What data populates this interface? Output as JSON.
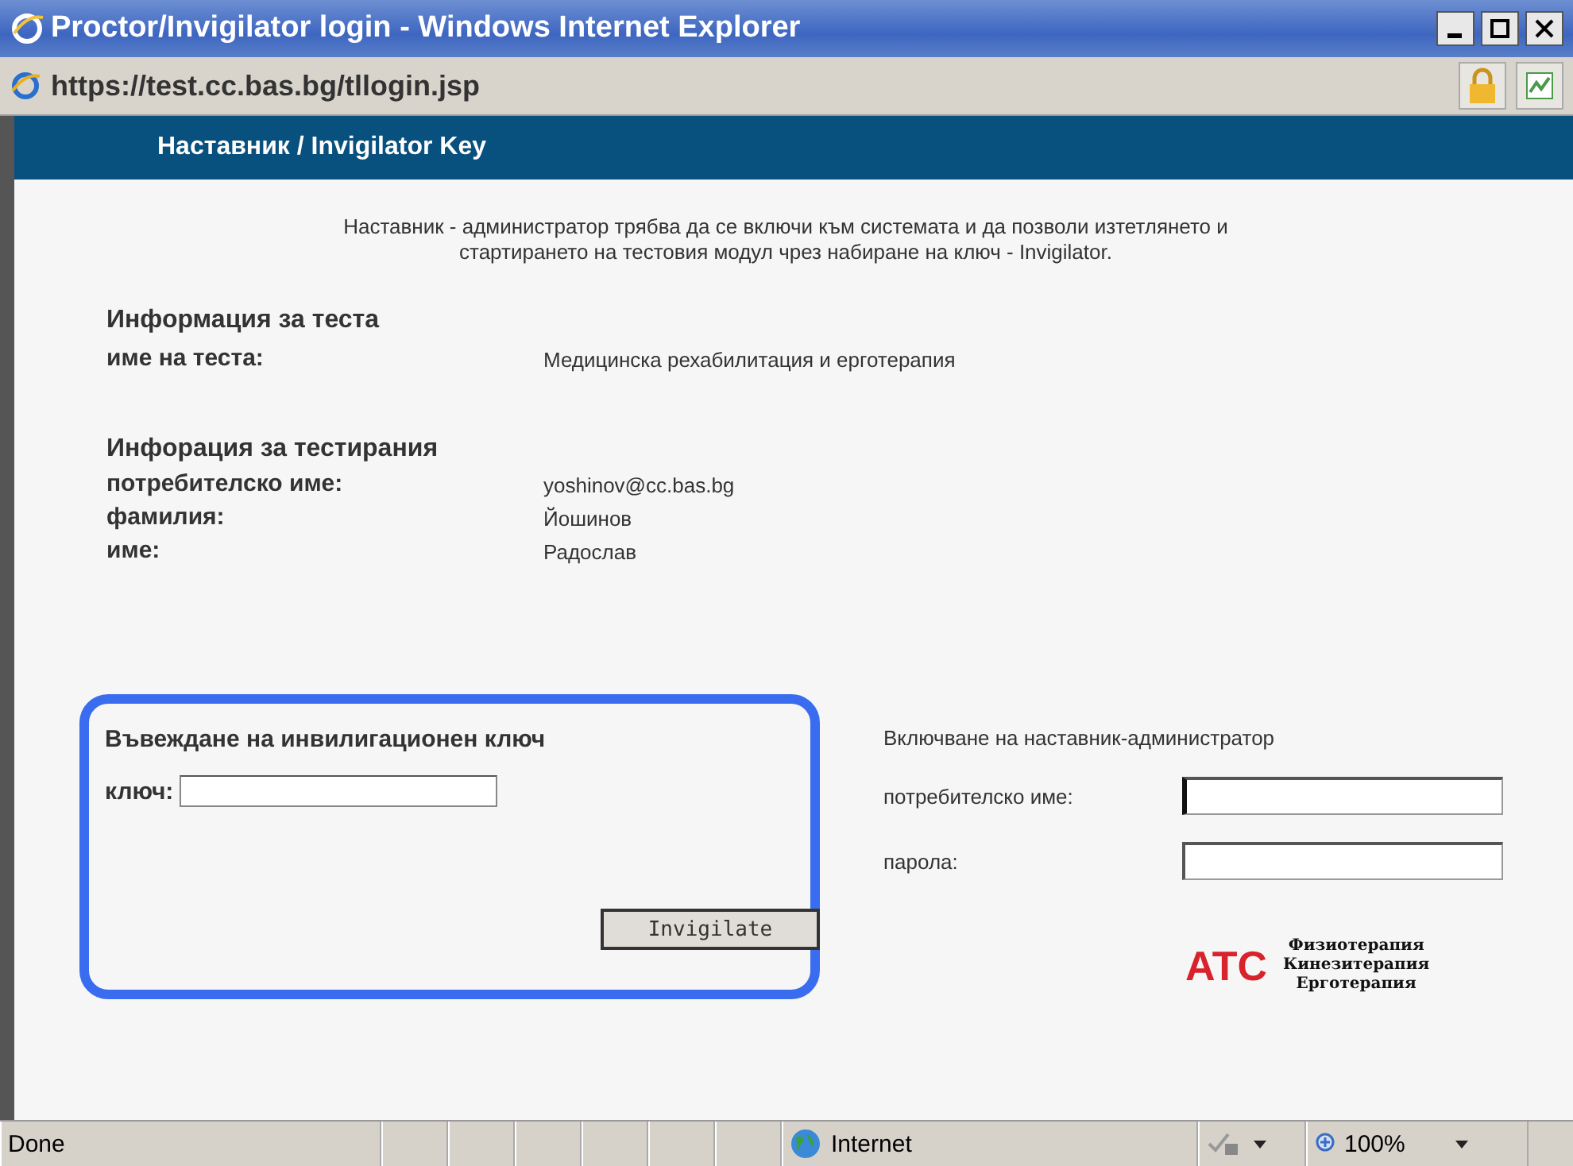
{
  "window": {
    "title": "Proctor/Invigilator login - Windows Internet Explorer"
  },
  "address": {
    "url": "https://test.cc.bas.bg/tllogin.jsp"
  },
  "header": {
    "title": "Наставник / Invigilator Key"
  },
  "intro": "Наставник - администратор трябва да се включи към системата и да позволи изтетлянето и стартирането на тестовия модул чрез набиране на ключ - Invigilator.",
  "test_info": {
    "heading": "Информация за теста",
    "rows": [
      {
        "label": "име на теста:",
        "value": "Медицинска рехабилитация и ерготерапия"
      }
    ]
  },
  "tester_info": {
    "heading": "Инфорация за тестирания",
    "rows": [
      {
        "label": "потребителско име:",
        "value": "yoshinov@cc.bas.bg"
      },
      {
        "label": "фамилия:",
        "value": "Йошинов"
      },
      {
        "label": "име:",
        "value": "Радослав"
      }
    ]
  },
  "key_box": {
    "heading": "Въвеждане на инвилигационен ключ",
    "field_label": "ключ:",
    "button": "Invigilate"
  },
  "admin_login": {
    "heading": "Включване на наставник-администратор",
    "fields": [
      {
        "label": "потребителско име:",
        "focused": true
      },
      {
        "label": "парола:",
        "focused": false
      }
    ]
  },
  "logo": {
    "mark": "ATC",
    "lines": [
      "Физиотерапия",
      "Кинезитерапия",
      "Ерготерапия"
    ]
  },
  "status_bar": {
    "status": "Done",
    "zone": "Internet",
    "zoom": "100%"
  }
}
